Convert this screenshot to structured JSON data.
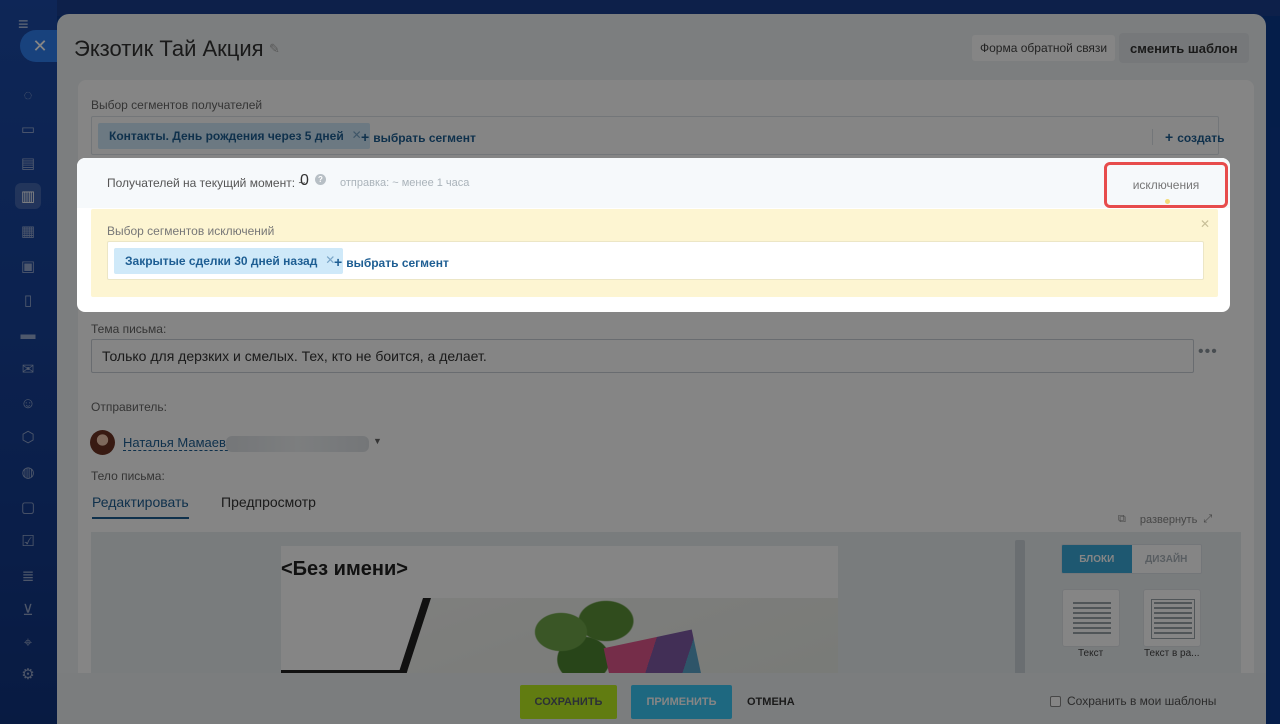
{
  "page": {
    "title": "Экзотик Тай Акция",
    "feedback_button": "Форма обратной связи",
    "change_template_button": "сменить шаблон"
  },
  "segments": {
    "label": "Выбор сегментов получателей",
    "chip": "Контакты. День рождения через 5 дней",
    "add_segment": "выбрать сегмент",
    "create": "создать"
  },
  "recipients": {
    "label": "Получателей на текущий момент: ~",
    "count": "0",
    "send_eta": "отправка: ~ менее 1 часа",
    "exclusions_link": "исключения"
  },
  "exclusions": {
    "label": "Выбор сегментов исключений",
    "chip": "Закрытые сделки 30 дней назад",
    "add_segment": "выбрать сегмент"
  },
  "subject": {
    "label": "Тема письма:",
    "value": "Только для дерзких и смелых. Тех, кто не боится, а делает."
  },
  "sender": {
    "label": "Отправитель:",
    "name": "Наталья Мамаева"
  },
  "body": {
    "label": "Тело письма:",
    "tabs": [
      "Редактировать",
      "Предпросмотр"
    ],
    "expand": "развернуть",
    "email_title": "<Без имени>",
    "side_tabs": [
      "БЛОКИ",
      "ДИЗАЙН"
    ],
    "blocks": [
      "Текст",
      "Текст в ра..."
    ]
  },
  "footer": {
    "save": "СОХРАНИТЬ",
    "apply": "ПРИМЕНИТЬ",
    "cancel": "ОТМЕНА",
    "save_template": "Сохранить в мои шаблоны"
  },
  "colors": {
    "accent_blue": "#1e5e93",
    "save_green": "#bbed21",
    "apply_blue": "#3bc8f5",
    "highlight_red": "#e74c4c",
    "exclusion_bg": "#fdf5d2"
  }
}
